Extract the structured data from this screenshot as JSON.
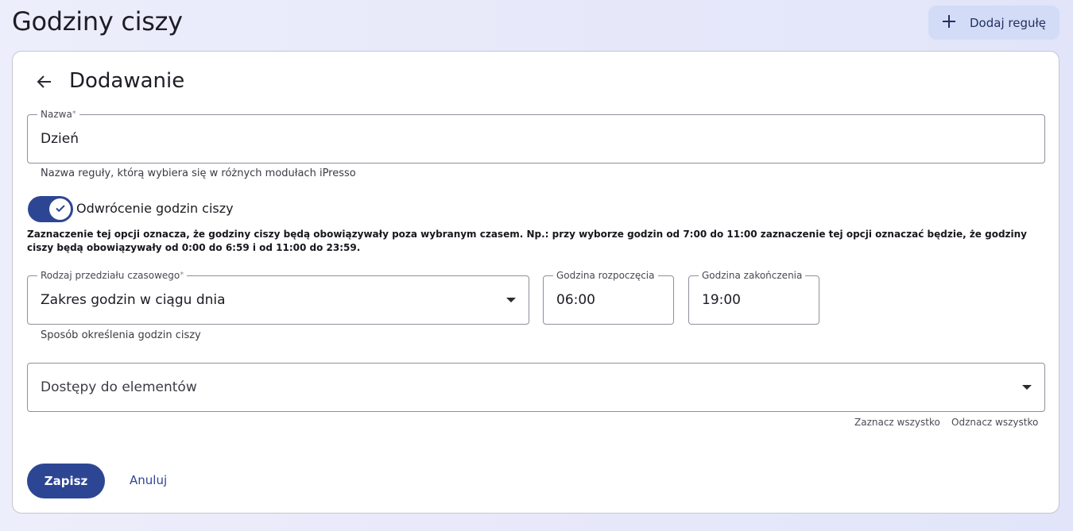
{
  "header": {
    "title": "Godziny ciszy",
    "add_rule_label": "Dodaj regułę"
  },
  "card": {
    "title": "Dodawanie"
  },
  "form": {
    "name": {
      "label": "Nazwa",
      "required_mark": "*",
      "value": "Dzień",
      "hint": "Nazwa reguły, którą wybiera się w różnych modułach iPresso"
    },
    "invert_toggle": {
      "label": "Odwrócenie godzin ciszy",
      "checked": true,
      "description": "Zaznaczenie tej opcji oznacza, że godziny ciszy będą obowiązywały poza wybranym czasem. Np.: przy wyborze godzin od 7:00 do 11:00 zaznaczenie tej opcji oznaczać będzie, że godziny ciszy będą obowiązywały od 0:00 do 6:59 i od 11:00 do 23:59."
    },
    "interval_type": {
      "label": "Rodzaj przedziału czasowego",
      "required_mark": "*",
      "value": "Zakres godzin w ciągu dnia",
      "hint": "Sposób określenia godzin ciszy"
    },
    "start_time": {
      "label": "Godzina rozpoczęcia",
      "value": "06:00"
    },
    "end_time": {
      "label": "Godzina zakończenia",
      "value": "19:00"
    },
    "access": {
      "placeholder": "Dostępy do elementów",
      "select_all": "Zaznacz wszystko",
      "deselect_all": "Odznacz wszystko"
    }
  },
  "actions": {
    "save": "Zapisz",
    "cancel": "Anuluj"
  },
  "colors": {
    "primary": "#2d4694",
    "add_button_bg": "#d3dcf6",
    "page_bg": "#e8eafa"
  },
  "icons": {
    "add": "plus-icon",
    "back": "arrow-left-icon",
    "toggle_check": "check-icon",
    "dropdown": "caret-down-icon"
  }
}
